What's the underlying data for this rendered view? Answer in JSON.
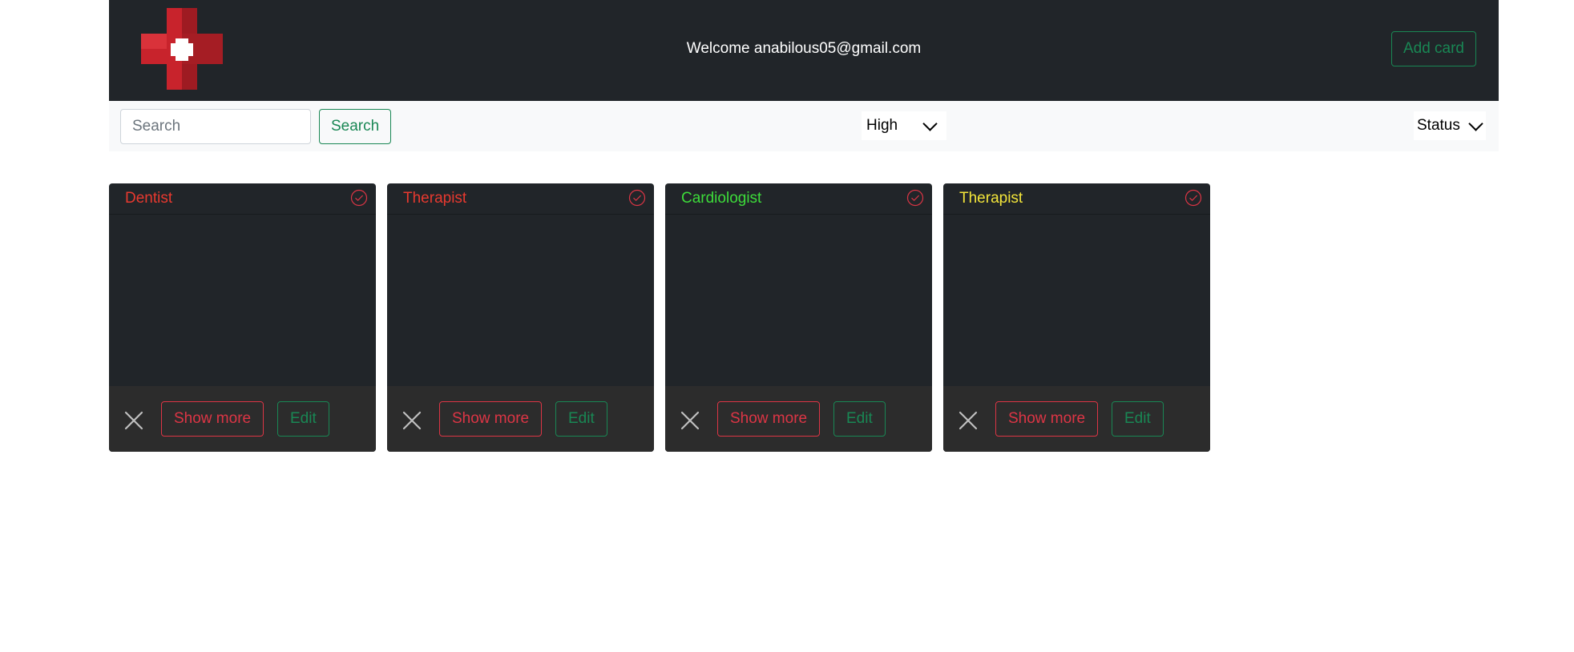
{
  "header": {
    "welcome": "Welcome anabilous05@gmail.com",
    "add_card_label": "Add card",
    "logo_icon": "red-cross-icon"
  },
  "toolbar": {
    "search_placeholder": "Search",
    "search_value": "",
    "search_button": "Search",
    "priority_selected": "High",
    "status_selected": "Status"
  },
  "cards": [
    {
      "title": "Dentist",
      "title_color": "#e8392f",
      "show_more": "Show more",
      "edit": "Edit"
    },
    {
      "title": "Therapist",
      "title_color": "#e8392f",
      "show_more": "Show more",
      "edit": "Edit"
    },
    {
      "title": "Cardiologist",
      "title_color": "#3ddc3a",
      "show_more": "Show more",
      "edit": "Edit"
    },
    {
      "title": "Therapist",
      "title_color": "#f3e53a",
      "show_more": "Show more",
      "edit": "Edit"
    }
  ],
  "colors": {
    "header_bg": "#212529",
    "toolbar_bg": "#f8f9fa",
    "success": "#198754",
    "danger": "#dc3545",
    "card_footer_bg": "#2c2c2c"
  }
}
